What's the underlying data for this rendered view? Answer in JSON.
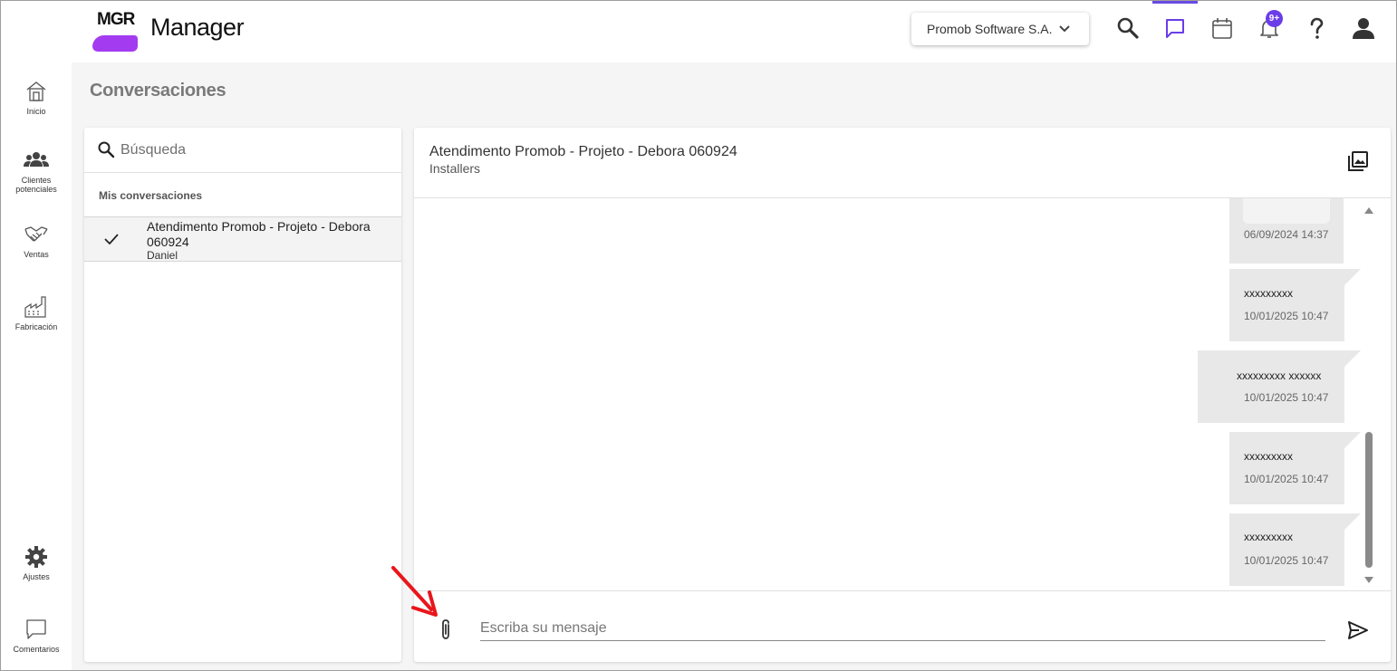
{
  "app": {
    "logo_text": "MGR",
    "name": "Manager"
  },
  "header": {
    "company": "Promob Software S.A.",
    "notification_badge": "9+",
    "icons": [
      "search-icon",
      "chat-icon",
      "calendar-icon",
      "bell-icon",
      "help-icon",
      "user-icon"
    ]
  },
  "nav": {
    "items": [
      {
        "label": "Inicio",
        "icon": "home-icon"
      },
      {
        "label": "Clientes potenciales",
        "icon": "people-icon"
      },
      {
        "label": "Ventas",
        "icon": "handshake-icon"
      },
      {
        "label": "Fabricación",
        "icon": "factory-icon"
      }
    ],
    "bottom": [
      {
        "label": "Ajustes",
        "icon": "gear-icon"
      },
      {
        "label": "Comentarios",
        "icon": "comment-icon"
      }
    ]
  },
  "page": {
    "title": "Conversaciones"
  },
  "list": {
    "search_placeholder": "Búsqueda",
    "section_label": "Mis conversaciones",
    "conversations": [
      {
        "title": "Atendimento Promob - Projeto - Debora 060924",
        "subtitle": "Daniel",
        "selected": true
      }
    ]
  },
  "chat": {
    "title": "Atendimento Promob - Projeto - Debora 060924",
    "subtitle": "Installers",
    "messages": [
      {
        "text": "",
        "time": "06/09/2024 14:37"
      },
      {
        "text": "xxxxxxxxx",
        "time": "10/01/2025 10:47"
      },
      {
        "text": "xxxxxxxxx xxxxxx",
        "time": "10/01/2025 10:47"
      },
      {
        "text": "xxxxxxxxx",
        "time": "10/01/2025 10:47"
      },
      {
        "text": "xxxxxxxxx",
        "time": "10/01/2025 10:47"
      }
    ],
    "input_placeholder": "Escriba su mensaje"
  },
  "colors": {
    "accent": "#6a3de8",
    "logo": "#a33cf0",
    "annotation": "#e8161b"
  }
}
